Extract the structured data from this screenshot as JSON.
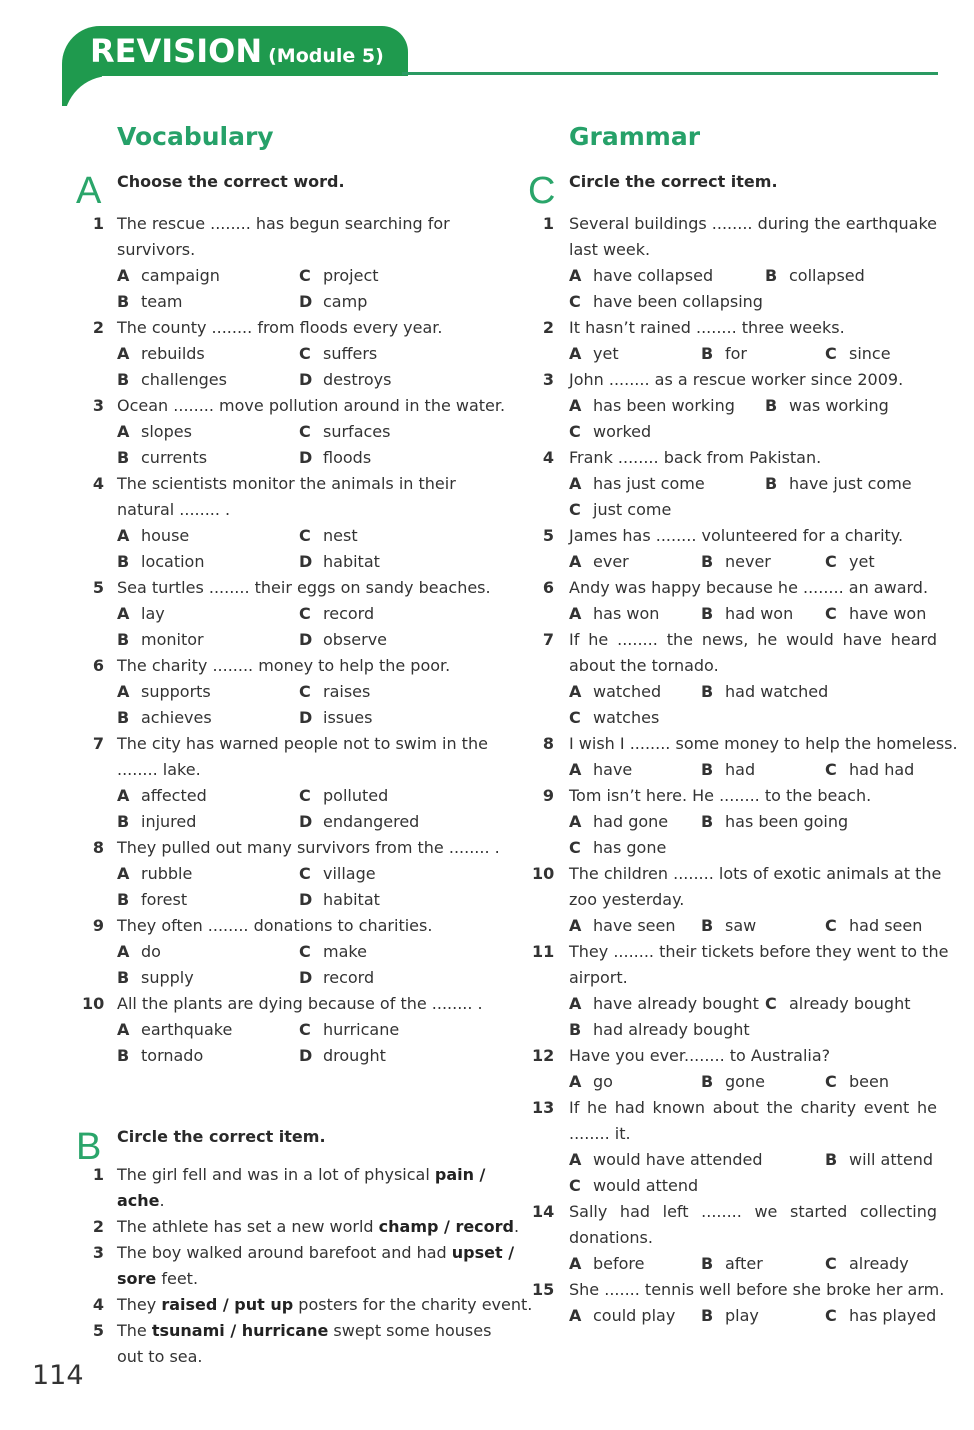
{
  "header": {
    "title": "REVISION",
    "subtitle": "(Module 5)",
    "accent_color": "#1f9a4e"
  },
  "vocabulary": {
    "title": "Vocabulary",
    "exercise_a": {
      "letter": "A",
      "instruction": "Choose the correct word.",
      "questions": [
        {
          "num": "1",
          "lines": [
            "The rescue ........ has begun searching for",
            "survivors."
          ],
          "options": [
            [
              "A",
              "campaign"
            ],
            [
              "C",
              "project"
            ],
            [
              "B",
              "team"
            ],
            [
              "D",
              "camp"
            ]
          ]
        },
        {
          "num": "2",
          "lines": [
            "The county ........ from floods every year."
          ],
          "options": [
            [
              "A",
              "rebuilds"
            ],
            [
              "C",
              "suffers"
            ],
            [
              "B",
              "challenges"
            ],
            [
              "D",
              "destroys"
            ]
          ]
        },
        {
          "num": "3",
          "lines": [
            "Ocean ........ move pollution around in the water."
          ],
          "options": [
            [
              "A",
              "slopes"
            ],
            [
              "C",
              "surfaces"
            ],
            [
              "B",
              "currents"
            ],
            [
              "D",
              "floods"
            ]
          ]
        },
        {
          "num": "4",
          "lines": [
            "The scientists monitor the animals in their",
            "natural ........ ."
          ],
          "options": [
            [
              "A",
              "house"
            ],
            [
              "C",
              "nest"
            ],
            [
              "B",
              "location"
            ],
            [
              "D",
              "habitat"
            ]
          ]
        },
        {
          "num": "5",
          "lines": [
            "Sea turtles ........ their eggs on sandy beaches."
          ],
          "options": [
            [
              "A",
              "lay"
            ],
            [
              "C",
              "record"
            ],
            [
              "B",
              "monitor"
            ],
            [
              "D",
              "observe"
            ]
          ]
        },
        {
          "num": "6",
          "lines": [
            "The charity ........ money to help the poor."
          ],
          "options": [
            [
              "A",
              "supports"
            ],
            [
              "C",
              "raises"
            ],
            [
              "B",
              "achieves"
            ],
            [
              "D",
              "issues"
            ]
          ]
        },
        {
          "num": "7",
          "lines": [
            "The city has warned people not to swim in the",
            "........ lake."
          ],
          "options": [
            [
              "A",
              "affected"
            ],
            [
              "C",
              "polluted"
            ],
            [
              "B",
              "injured"
            ],
            [
              "D",
              "endangered"
            ]
          ]
        },
        {
          "num": "8",
          "lines": [
            "They pulled out many survivors from the ........ ."
          ],
          "options": [
            [
              "A",
              "rubble"
            ],
            [
              "C",
              "village"
            ],
            [
              "B",
              "forest"
            ],
            [
              "D",
              "habitat"
            ]
          ]
        },
        {
          "num": "9",
          "lines": [
            "They often ........ donations to charities."
          ],
          "options": [
            [
              "A",
              "do"
            ],
            [
              "C",
              "make"
            ],
            [
              "B",
              "supply"
            ],
            [
              "D",
              "record"
            ]
          ]
        },
        {
          "num": "10",
          "lines": [
            "All the plants are dying because of the ........ ."
          ],
          "options": [
            [
              "A",
              "earthquake"
            ],
            [
              "C",
              "hurricane"
            ],
            [
              "B",
              "tornado"
            ],
            [
              "D",
              "drought"
            ]
          ]
        }
      ]
    },
    "exercise_b": {
      "letter": "B",
      "instruction": "Circle the correct item.",
      "questions": [
        {
          "num": "1",
          "parts": [
            [
              "The girl fell and was in a lot of physical ",
              false
            ],
            [
              "pain /",
              true
            ]
          ],
          "parts2": [
            [
              "ache",
              true
            ],
            [
              ".",
              false
            ]
          ]
        },
        {
          "num": "2",
          "parts": [
            [
              "The athlete has set a new world ",
              false
            ],
            [
              "champ / record",
              true
            ],
            [
              ".",
              false
            ]
          ]
        },
        {
          "num": "3",
          "parts": [
            [
              "The boy walked around barefoot and had ",
              false
            ],
            [
              "upset /",
              true
            ]
          ],
          "parts2": [
            [
              "sore",
              true
            ],
            [
              " feet.",
              false
            ]
          ]
        },
        {
          "num": "4",
          "parts": [
            [
              "They ",
              false
            ],
            [
              "raised / put up",
              true
            ],
            [
              " posters for the charity event.",
              false
            ]
          ]
        },
        {
          "num": "5",
          "parts": [
            [
              "The ",
              false
            ],
            [
              "tsunami / hurricane",
              true
            ],
            [
              " swept some houses",
              false
            ]
          ],
          "parts2": [
            [
              "out to sea.",
              false
            ]
          ]
        }
      ]
    }
  },
  "grammar": {
    "title": "Grammar",
    "exercise_c": {
      "letter": "C",
      "instruction": "Circle the correct item.",
      "questions": [
        {
          "num": "1",
          "lines": [
            "Several buildings ........ during the earthquake",
            "last week."
          ],
          "options": [
            [
              "A",
              "have collapsed"
            ],
            [
              "B",
              "collapsed"
            ],
            [
              "C",
              "have been collapsing"
            ]
          ]
        },
        {
          "num": "2",
          "lines": [
            "It hasn’t rained ........ three weeks."
          ],
          "options": [
            [
              "A",
              "yet"
            ],
            [
              "B",
              "for"
            ],
            [
              "C",
              "since"
            ]
          ]
        },
        {
          "num": "3",
          "lines": [
            "John ........ as a rescue worker since 2009."
          ],
          "options": [
            [
              "A",
              "has been working"
            ],
            [
              "B",
              "was working"
            ],
            [
              "C",
              "worked"
            ]
          ]
        },
        {
          "num": "4",
          "lines": [
            "Frank ........ back from Pakistan."
          ],
          "options": [
            [
              "A",
              "has just come"
            ],
            [
              "B",
              "have just come"
            ],
            [
              "C",
              "just come"
            ]
          ]
        },
        {
          "num": "5",
          "lines": [
            "James has ........ volunteered for a charity."
          ],
          "options": [
            [
              "A",
              "ever"
            ],
            [
              "B",
              "never"
            ],
            [
              "C",
              "yet"
            ]
          ]
        },
        {
          "num": "6",
          "lines": [
            "Andy was happy because he ........ an award."
          ],
          "options": [
            [
              "A",
              "has won"
            ],
            [
              "B",
              "had won"
            ],
            [
              "C",
              "have won"
            ]
          ]
        },
        {
          "num": "7",
          "lines": [
            "If he ........ the news, he would have heard",
            "about the tornado."
          ],
          "options": [
            [
              "A",
              "watched"
            ],
            [
              "B",
              "had watched"
            ],
            [
              "C",
              "watches"
            ]
          ]
        },
        {
          "num": "8",
          "lines": [
            "I wish I ........ some money to help the homeless."
          ],
          "options": [
            [
              "A",
              "have"
            ],
            [
              "B",
              "had"
            ],
            [
              "C",
              "had had"
            ]
          ]
        },
        {
          "num": "9",
          "lines": [
            "Tom isn’t here. He ........ to the beach."
          ],
          "options": [
            [
              "A",
              "had gone"
            ],
            [
              "B",
              "has been going"
            ],
            [
              "C",
              "has gone"
            ]
          ]
        },
        {
          "num": "10",
          "lines": [
            "The children ........ lots of exotic animals  at the",
            "zoo yesterday."
          ],
          "options": [
            [
              "A",
              "have seen"
            ],
            [
              "B",
              "saw"
            ],
            [
              "C",
              "had seen"
            ]
          ]
        },
        {
          "num": "11",
          "lines": [
            "They ........ their tickets before they went to the",
            "airport."
          ],
          "options": [
            [
              "A",
              "have already bought"
            ],
            [
              "C",
              "already bought"
            ],
            [
              "B",
              "had already bought"
            ]
          ]
        },
        {
          "num": "12",
          "lines": [
            "Have you ever........ to Australia?"
          ],
          "options": [
            [
              "A",
              "go"
            ],
            [
              "B",
              "gone"
            ],
            [
              "C",
              "been"
            ]
          ]
        },
        {
          "num": "13",
          "lines": [
            "If he had known about the charity event he",
            "........ it."
          ],
          "options": [
            [
              "A",
              "would have attended"
            ],
            [
              "B",
              "will attend"
            ],
            [
              "C",
              "would attend"
            ]
          ]
        },
        {
          "num": "14",
          "lines": [
            "Sally had left ........ we started collecting",
            "donations."
          ],
          "options": [
            [
              "A",
              "before"
            ],
            [
              "B",
              "after"
            ],
            [
              "C",
              "already"
            ]
          ]
        },
        {
          "num": "15",
          "lines": [
            "She ....... tennis well before she broke her arm."
          ],
          "options": [
            [
              "A",
              "could play"
            ],
            [
              "B",
              "play"
            ],
            [
              "C",
              "has played"
            ]
          ]
        }
      ]
    }
  },
  "page_number": "114"
}
